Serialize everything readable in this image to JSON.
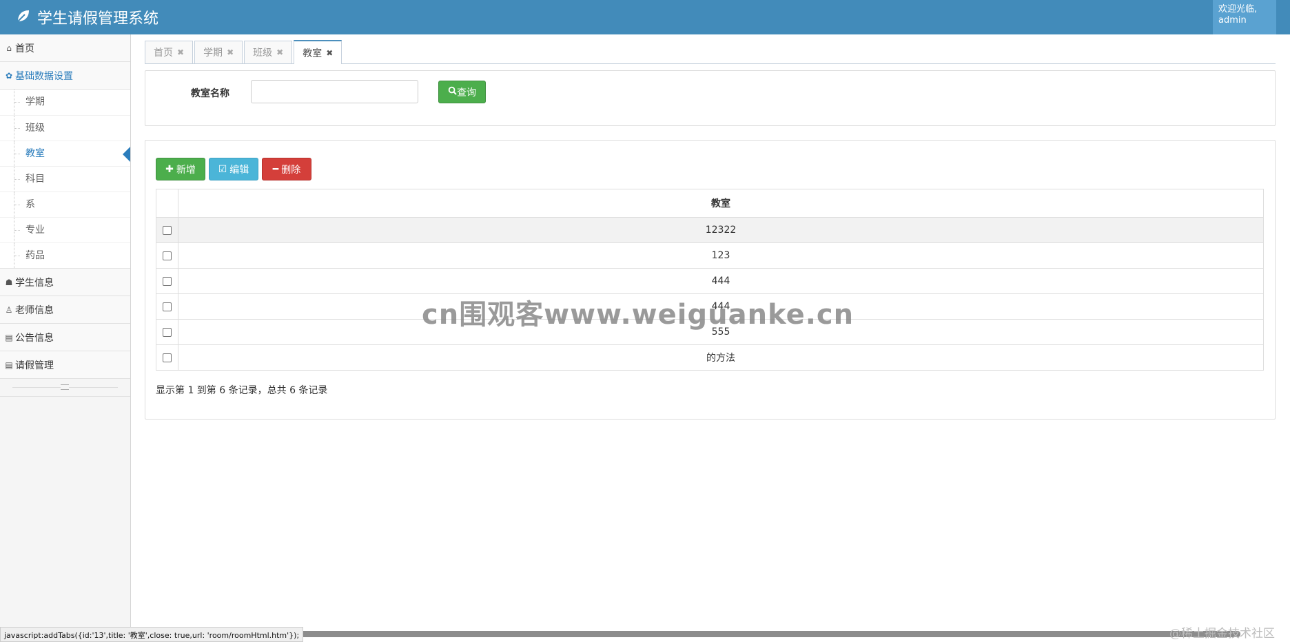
{
  "app": {
    "title": "学生请假管理系统",
    "welcome_line1": "欢迎光临,",
    "welcome_line2": "admin",
    "brand_color": "#428bba"
  },
  "sidebar": {
    "items": [
      {
        "label": "首页",
        "icon": "home-icon"
      },
      {
        "label": "基础数据设置",
        "icon": "gear-icon"
      },
      {
        "label": "学生信息",
        "icon": "users-icon"
      },
      {
        "label": "老师信息",
        "icon": "user-icon"
      },
      {
        "label": "公告信息",
        "icon": "document-icon"
      },
      {
        "label": "请假管理",
        "icon": "document-icon"
      }
    ],
    "submenu": [
      "学期",
      "班级",
      "教室",
      "科目",
      "系",
      "专业",
      "药品"
    ],
    "active_submenu": "教室"
  },
  "tabs": [
    {
      "label": "首页"
    },
    {
      "label": "学期"
    },
    {
      "label": "班级"
    },
    {
      "label": "教室"
    }
  ],
  "search": {
    "label": "教室名称",
    "value": "",
    "button": "查询"
  },
  "toolbar": {
    "add": "新增",
    "edit": "编辑",
    "delete": "删除"
  },
  "table": {
    "header": "教室",
    "rows": [
      "12322",
      "123",
      "444",
      "444",
      "555",
      "的方法"
    ]
  },
  "pager": "显示第 1 到第 6 条记录，总共 6 条记录",
  "watermark": "cn围观客www.weiguanke.cn",
  "statusbar": "javascript:addTabs({id:'13',title: '教室',close: true,url: 'room/roomHtml.htm'});",
  "credit": "@稀土掘金技术社区"
}
